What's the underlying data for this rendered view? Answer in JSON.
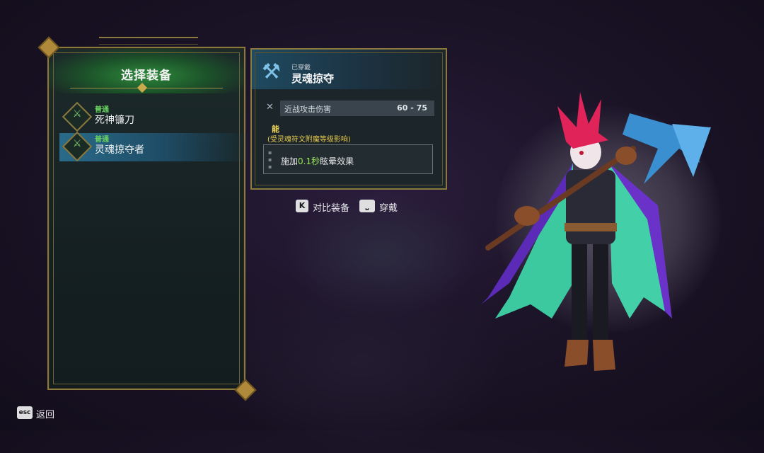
{
  "panel": {
    "title": "选择装备",
    "items": [
      {
        "rarity": "普通",
        "name": "死神镰刀",
        "icon": "scythe-icon",
        "selected": false
      },
      {
        "rarity": "普通",
        "name": "灵魂掠夺者",
        "icon": "scythe-icon",
        "selected": true
      }
    ]
  },
  "detail": {
    "equipped_tag": "已穿戴",
    "weapon_name": "灵魂掠夺",
    "stat_label": "近战攻击伤害",
    "stat_value": "60 - 75",
    "ability_title": "能",
    "ability_note": "(受灵魂符文附魔等级影响)",
    "ability_prefix": "施加",
    "ability_highlight": "0.1秒",
    "ability_suffix": "眩晕效果"
  },
  "hints": {
    "compare_key": "K",
    "compare_label": "对比装备",
    "equip_label": "穿戴"
  },
  "footer": {
    "esc_key": "esc",
    "back_label": "返回"
  },
  "colors": {
    "rarity_common": "#68d160",
    "frame_gold": "#8a7a3e",
    "highlight": "#9be15a",
    "selected_row": "#2a6b8a"
  }
}
